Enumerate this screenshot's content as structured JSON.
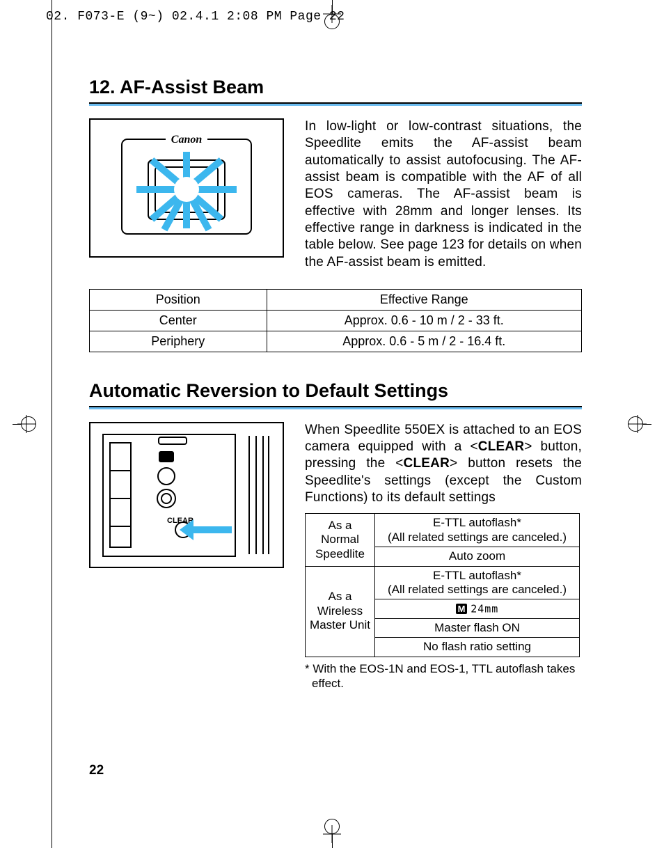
{
  "slugline": "02. F073-E (9~)  02.4.1 2:08 PM  Page 22",
  "section1": {
    "heading": "12. AF-Assist Beam",
    "body": "In low-light or low-contrast situations, the Speedlite emits the AF-assist beam automatically to assist autofocusing. The AF-assist beam is compatible with the AF of all EOS cameras. The AF-assist beam is effective with 28mm and longer lenses. Its effective range in darkness is indicated in the table below. See page 123 for details on when the AF-assist beam is emitted.",
    "illustration_label": "Canon"
  },
  "table1": {
    "headers": [
      "Position",
      "Effective Range"
    ],
    "rows": [
      [
        "Center",
        "Approx. 0.6 - 10 m / 2 - 33 ft."
      ],
      [
        "Periphery",
        "Approx. 0.6 - 5 m / 2 - 16.4 ft."
      ]
    ]
  },
  "section2": {
    "heading": "Automatic Reversion to Default Settings",
    "body_pre": "When Speedlite 550EX is attached to an EOS camera equipped with a <",
    "clear1": "CLEAR",
    "body_mid": "> button, pressing the <",
    "clear2": "CLEAR",
    "body_post": "> button resets the Speedlite's settings (except the Custom Functions) to its default settings",
    "illustration_button": "CLEAR"
  },
  "table2": {
    "row1_label": "As a Normal Speedlite",
    "row1_v1a": "E-TTL autoflash*",
    "row1_v1b": "(All related settings are canceled.)",
    "row1_v2": "Auto zoom",
    "row2_label": "As a Wireless Master Unit",
    "row2_v1a": "E-TTL autoflash*",
    "row2_v1b": "(All related settings are canceled.)",
    "row2_v2_icon": "M",
    "row2_v2_text": "24mm",
    "row2_v3": "Master flash ON",
    "row2_v4": "No flash ratio setting"
  },
  "footnote": "* With the EOS-1N and EOS-1, TTL autoflash takes effect.",
  "page_number": "22"
}
